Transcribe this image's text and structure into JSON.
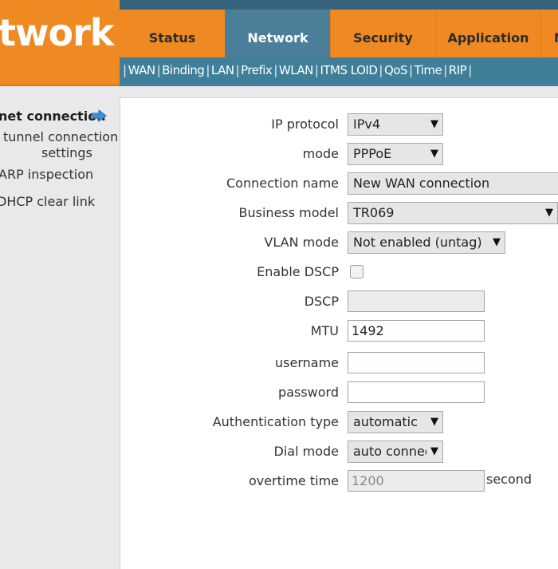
{
  "header": {
    "logo_text": "twork",
    "tabs": [
      {
        "label": "Status"
      },
      {
        "label": "Network"
      },
      {
        "label": "Security"
      },
      {
        "label": "Application"
      },
      {
        "label": "M"
      }
    ],
    "subnav": [
      "WAN",
      "Binding",
      "LAN",
      "Prefix",
      "WLAN",
      "ITMS LOID",
      "QoS",
      "Time",
      "RIP"
    ]
  },
  "sidebar": {
    "items": [
      {
        "label": "net connection"
      },
      {
        "label_line1": "tunnel connection",
        "label_line2": "settings"
      },
      {
        "label": "ARP inspection"
      },
      {
        "label": "DHCP clear link"
      }
    ]
  },
  "form": {
    "ip_protocol": {
      "label": "IP protocol",
      "value": "IPv4"
    },
    "mode": {
      "label": "mode",
      "value": "PPPoE"
    },
    "connection_name": {
      "label": "Connection name",
      "value": "New WAN connection"
    },
    "business_model": {
      "label": "Business model",
      "value": "TR069"
    },
    "vlan_mode": {
      "label": "VLAN mode",
      "value": "Not enabled (untag)"
    },
    "enable_dscp": {
      "label": "Enable DSCP",
      "checked": false
    },
    "dscp": {
      "label": "DSCP",
      "value": ""
    },
    "mtu": {
      "label": "MTU",
      "value": "1492"
    },
    "username": {
      "label": "username",
      "value": ""
    },
    "password": {
      "label": "password",
      "value": ""
    },
    "auth_type": {
      "label": "Authentication type",
      "value": "automatic"
    },
    "dial_mode": {
      "label": "Dial mode",
      "value": "auto connec"
    },
    "overtime": {
      "label": "overtime time",
      "value": "1200",
      "unit": "second"
    }
  },
  "colors": {
    "orange": "#ef8a22",
    "active_tab": "#4a7e99",
    "subnav": "#3f7f99",
    "topband": "#36647f",
    "arrow_blue": "#3b8fd6"
  }
}
